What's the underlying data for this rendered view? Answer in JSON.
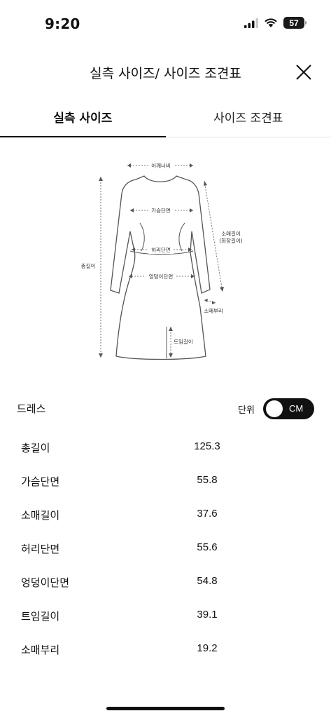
{
  "status_bar": {
    "time": "9:20",
    "battery": "57",
    "icons": [
      "signal-icon",
      "wifi-icon",
      "battery-icon"
    ]
  },
  "header": {
    "title": "실측 사이즈/ 사이즈 조견표",
    "close_icon": "close-icon"
  },
  "tabs": [
    {
      "label": "실측 사이즈",
      "active": true
    },
    {
      "label": "사이즈 조견표",
      "active": false
    }
  ],
  "diagram": {
    "labels": {
      "shoulder": "어깨너비",
      "chest": "가슴단면",
      "waist": "허리단면",
      "hip": "엉덩이단면",
      "total_length": "총길이",
      "sleeve_length_1": "소매길이",
      "sleeve_length_2": "(화장길이)",
      "sleeve_cuff": "소매부리",
      "slit_length": "트임길이"
    }
  },
  "section": {
    "title": "드레스",
    "unit_label": "단위",
    "unit_value": "CM"
  },
  "measurements": [
    {
      "name": "총길이",
      "value": "125.3"
    },
    {
      "name": "가슴단면",
      "value": "55.8"
    },
    {
      "name": "소매길이",
      "value": "37.6"
    },
    {
      "name": "허리단면",
      "value": "55.6"
    },
    {
      "name": "엉덩이단면",
      "value": "54.8"
    },
    {
      "name": "트임길이",
      "value": "39.1"
    },
    {
      "name": "소매부리",
      "value": "19.2"
    }
  ]
}
